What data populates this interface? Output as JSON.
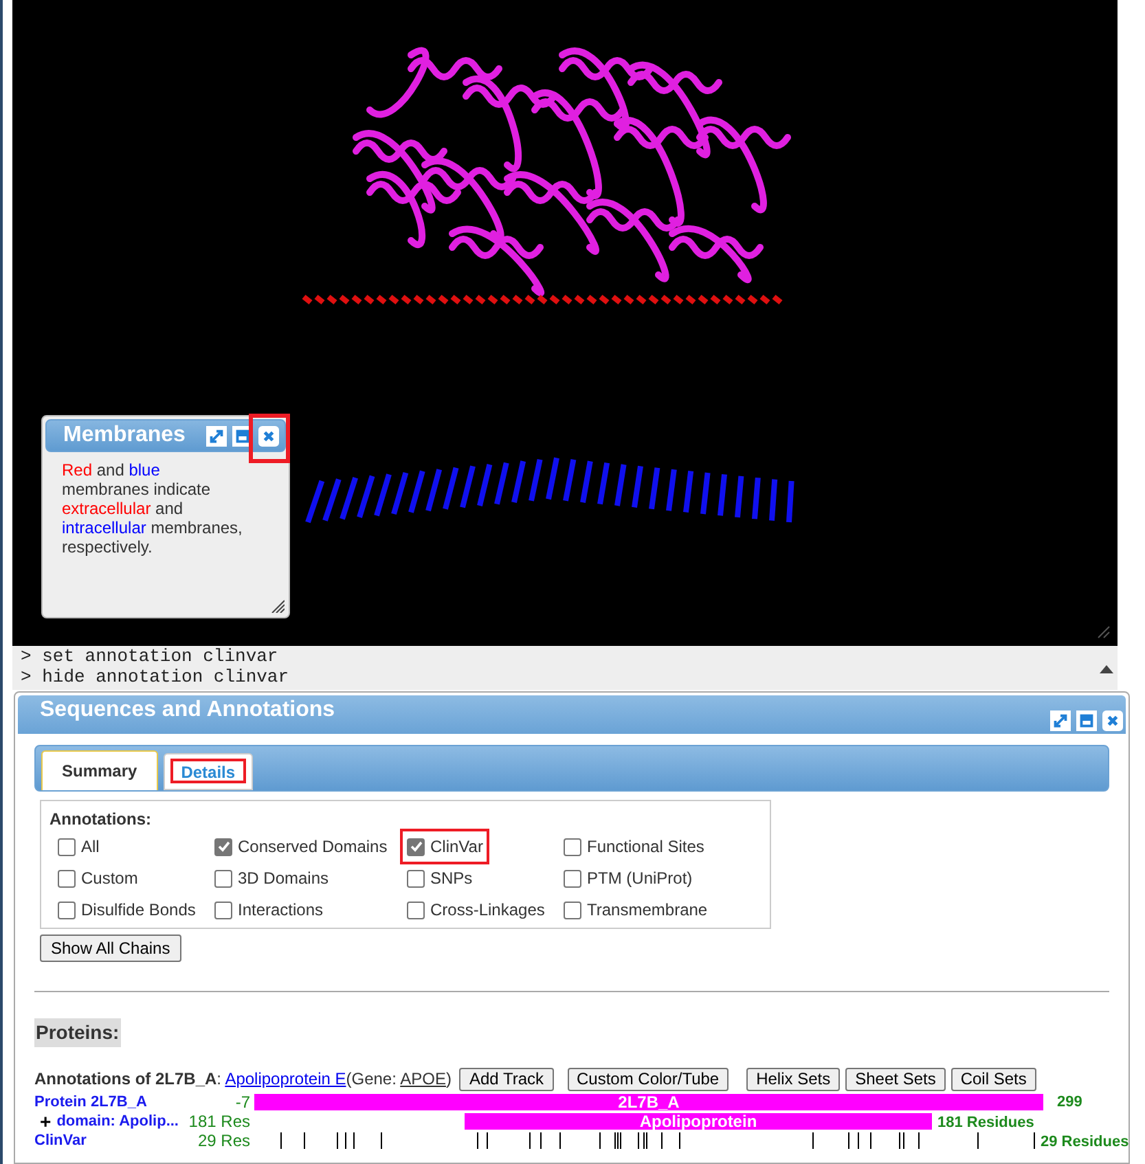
{
  "viewer": {
    "membranes_popup": {
      "title": "Membranes",
      "segments": [
        {
          "text": "Red",
          "color": "#ff0000"
        },
        {
          "text": " and ",
          "color": "#333333"
        },
        {
          "text": "blue",
          "color": "#0000ff"
        },
        {
          "text": " membranes indicate ",
          "color": "#333333"
        },
        {
          "text": "extracellular",
          "color": "#ff0000"
        },
        {
          "text": " and ",
          "color": "#333333"
        },
        {
          "text": "intracellular",
          "color": "#0000ff"
        },
        {
          "text": " membranes, respectively.",
          "color": "#333333"
        }
      ],
      "buttons": [
        {
          "kind": "expand",
          "highlighted": false
        },
        {
          "kind": "minimize",
          "highlighted": false
        },
        {
          "kind": "close",
          "highlighted": true
        }
      ]
    }
  },
  "console": {
    "lines": [
      "> set annotation clinvar",
      "> hide annotation clinvar"
    ]
  },
  "panel": {
    "title": "Sequences and Annotations",
    "header_buttons": [
      {
        "kind": "expand"
      },
      {
        "kind": "minimize"
      },
      {
        "kind": "close"
      }
    ],
    "tabs": [
      {
        "label": "Summary",
        "selected": true,
        "highlighted": false
      },
      {
        "label": "Details",
        "selected": false,
        "highlighted": true
      }
    ],
    "annotations": {
      "label": "Annotations:",
      "options": [
        {
          "label": "All",
          "checked": false,
          "highlighted": false
        },
        {
          "label": "Conserved Domains",
          "checked": true,
          "highlighted": false
        },
        {
          "label": "ClinVar",
          "checked": true,
          "highlighted": true
        },
        {
          "label": "Functional Sites",
          "checked": false,
          "highlighted": false
        },
        {
          "label": "Custom",
          "checked": false,
          "highlighted": false
        },
        {
          "label": "3D Domains",
          "checked": false,
          "highlighted": false
        },
        {
          "label": "SNPs",
          "checked": false,
          "highlighted": false
        },
        {
          "label": "PTM (UniProt)",
          "checked": false,
          "highlighted": false
        },
        {
          "label": "Disulfide Bonds",
          "checked": false,
          "highlighted": false
        },
        {
          "label": "Interactions",
          "checked": false,
          "highlighted": false
        },
        {
          "label": "Cross-Linkages",
          "checked": false,
          "highlighted": false
        },
        {
          "label": "Transmembrane",
          "checked": false,
          "highlighted": false
        }
      ]
    },
    "show_all_chains": "Show All Chains",
    "proteins_heading": "Proteins:",
    "annotations_of": {
      "prefix": "**Annotations of 2L7B_A**: ",
      "protein_link": "Apolipoprotein E",
      "gene_prefix": "(Gene: ",
      "gene_link": "APOE",
      "gene_suffix": ")"
    },
    "buttons": [
      "Add Track",
      "Custom Color/Tube",
      "Helix Sets",
      "Sheet Sets",
      "Coil Sets"
    ],
    "tracks": [
      {
        "kind": "protein",
        "name": "Protein 2L7B_A",
        "count": "-7",
        "bar_label": "2L7B_A",
        "end": "299"
      },
      {
        "kind": "domain",
        "expander": "+",
        "name": "domain: Apolip...",
        "count": "181 Res",
        "bar_label": "Apolipoprotein",
        "end": "181 Residues"
      },
      {
        "kind": "clinvar",
        "name": "ClinVar",
        "count": "29 Res",
        "end": "29 Residues"
      }
    ]
  }
}
